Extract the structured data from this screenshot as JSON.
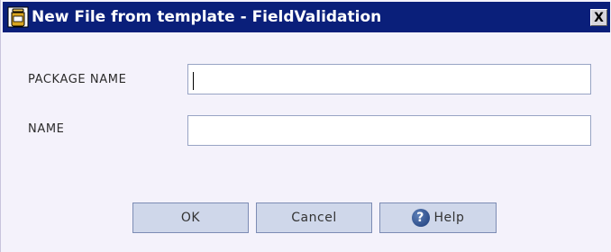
{
  "window": {
    "title": "New File from template - FieldValidation",
    "close_glyph": "X",
    "title_icon": "package-jar-icon"
  },
  "form": {
    "package_name_label": "PACKAGE NAME",
    "package_name_value": "",
    "name_label": "NAME",
    "name_value": ""
  },
  "buttons": {
    "ok": "OK",
    "cancel": "Cancel",
    "help": "Help",
    "help_icon": "help-question-icon",
    "help_glyph": "?"
  },
  "colors": {
    "titlebar": "#0a1f7a",
    "dialog_bg": "#f4f2fb",
    "button_bg": "#cfd7ea",
    "field_border": "#98a4c4"
  }
}
